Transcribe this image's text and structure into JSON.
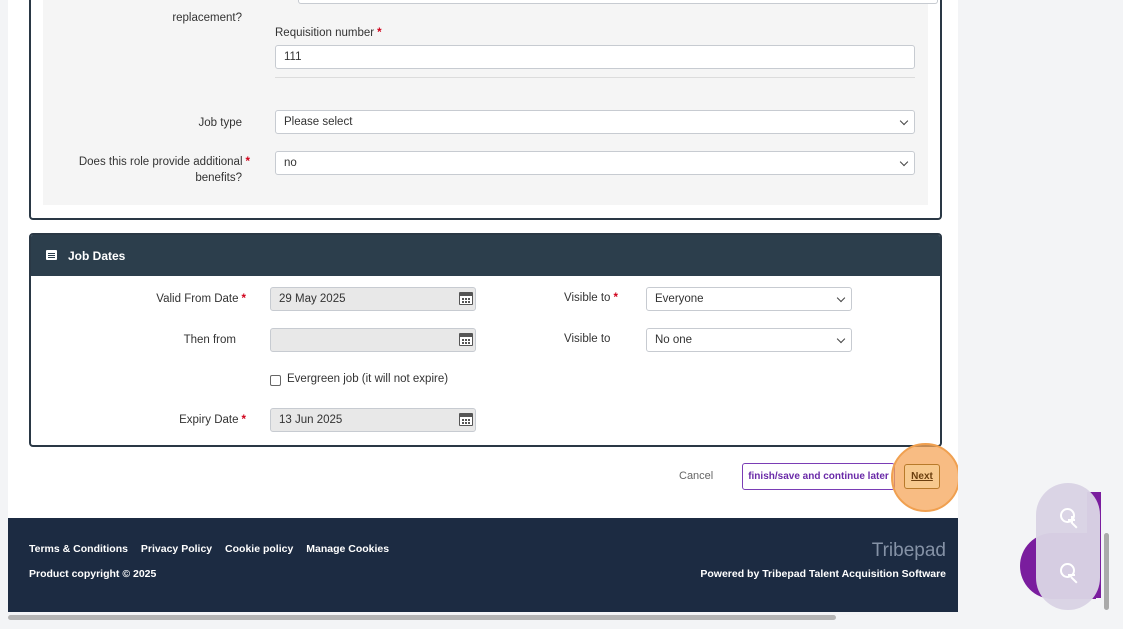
{
  "upper_section": {
    "replacement_label_tail": "replacement?",
    "requisition": {
      "label": "Requisition number",
      "value": "111"
    },
    "job_type": {
      "label": "Job type",
      "value": "Please select"
    },
    "benefits": {
      "label_line1": "Does this role provide additional",
      "label_line2": "benefits?",
      "value": "no"
    }
  },
  "job_dates": {
    "title": "Job Dates",
    "valid_from": {
      "label": "Valid From Date",
      "value": "29 May 2025"
    },
    "then_from": {
      "label": "Then from",
      "value": ""
    },
    "evergreen": {
      "label": "Evergreen job (it will not expire)",
      "checked": false
    },
    "expiry": {
      "label": "Expiry Date",
      "value": "13 Jun 2025"
    },
    "visible_to_1": {
      "label": "Visible to",
      "value": "Everyone"
    },
    "visible_to_2": {
      "label": "Visible to",
      "value": "No one"
    }
  },
  "actions": {
    "cancel": "Cancel",
    "finish": "finish/save and continue later",
    "next": "Next"
  },
  "footer": {
    "links": [
      "Terms & Conditions",
      "Privacy Policy",
      "Cookie policy",
      "Manage Cookies"
    ],
    "copyright": "Product copyright © 2025",
    "brand": "Tribepad",
    "powered": "Powered by Tribepad Talent Acquisition Software"
  },
  "colors": {
    "header_dark": "#2c3e4c",
    "footer_bg": "#1c2b42",
    "accent_purple": "#6a2aa8",
    "required": "#d0021b",
    "highlight": "#f5a65a"
  }
}
